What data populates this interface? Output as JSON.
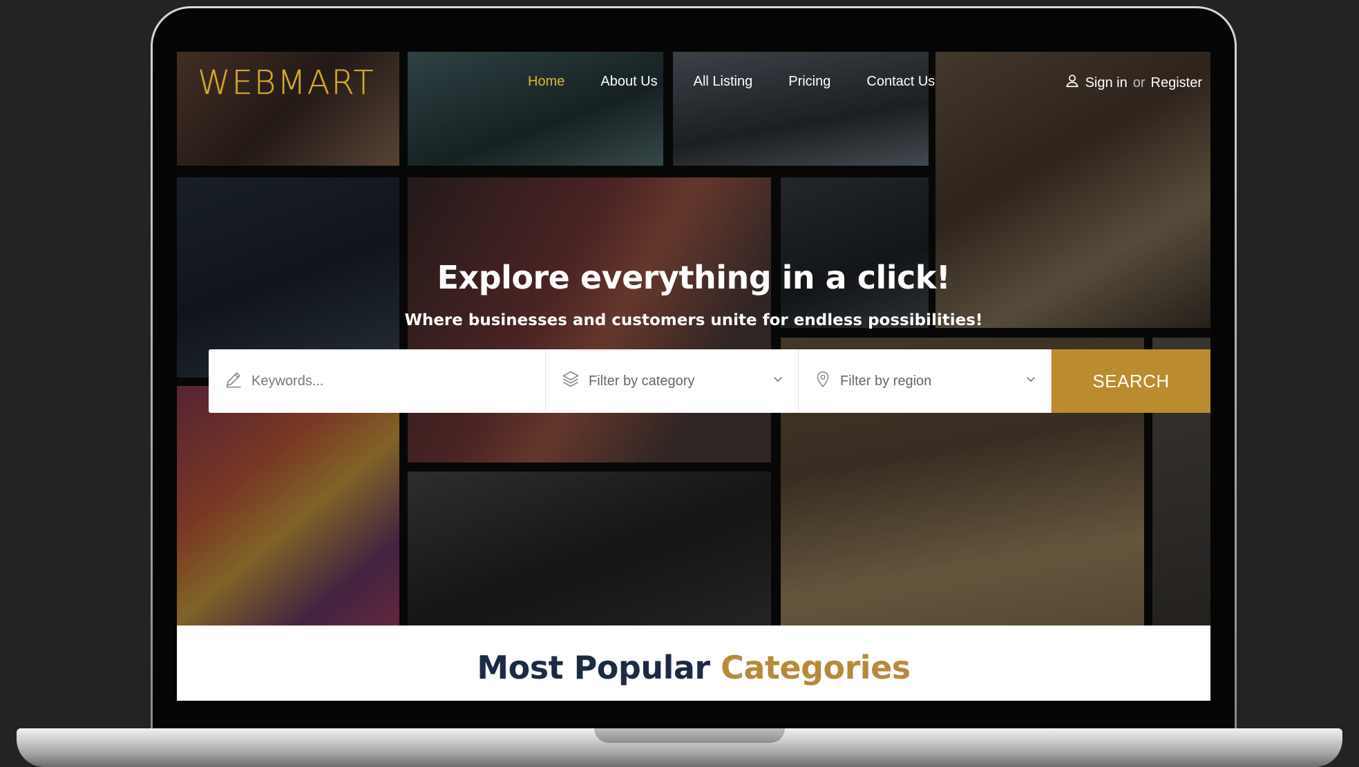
{
  "brand": {
    "logo": "WEBMART",
    "accent_color": "#d4a92c"
  },
  "nav": {
    "items": [
      {
        "label": "Home",
        "active": true
      },
      {
        "label": "About Us",
        "active": false
      },
      {
        "label": "All Listing",
        "active": false
      },
      {
        "label": "Pricing",
        "active": false
      },
      {
        "label": "Contact Us",
        "active": false
      }
    ]
  },
  "auth": {
    "sign_in": "Sign in",
    "or": "or",
    "register": "Register",
    "icon": "user-icon"
  },
  "hero": {
    "headline": "Explore everything in a click!",
    "subline": "Where businesses and customers unite for endless possibilities!"
  },
  "search": {
    "keyword_placeholder": "Keywords...",
    "category_label": "Filter by category",
    "region_label": "Filter by region",
    "button_label": "SEARCH",
    "button_color": "#bb8c2f"
  },
  "section": {
    "title_part1": "Most Popular",
    "title_part2": "Categories",
    "title_color": "#1d2a44",
    "accent_color": "#b8893a"
  }
}
